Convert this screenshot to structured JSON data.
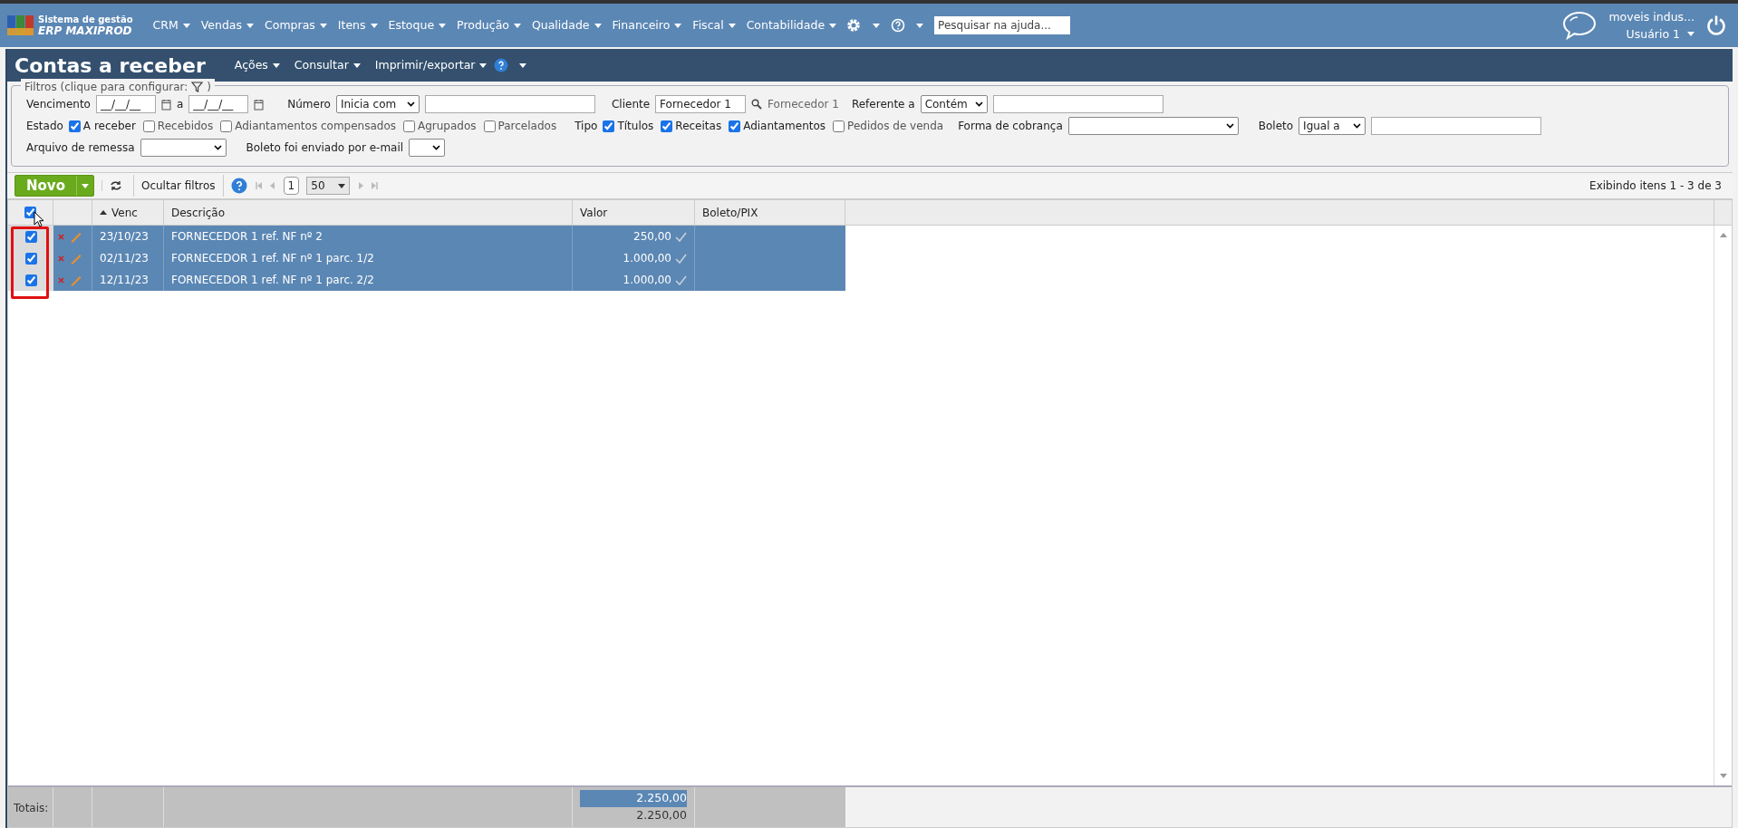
{
  "top_nav": {
    "logo": {
      "line1": "Sistema de gestão",
      "line2": "ERP MAXIPROD"
    },
    "menus": [
      "CRM",
      "Vendas",
      "Compras",
      "Itens",
      "Estoque",
      "Produção",
      "Qualidade",
      "Financeiro",
      "Fiscal",
      "Contabilidade"
    ],
    "search": {
      "placeholder": "Pesquisar na ajuda..."
    },
    "user": {
      "company": "moveis indus...",
      "name": "Usuário 1"
    }
  },
  "page": {
    "title": "Contas a receber",
    "actions": [
      "Ações",
      "Consultar",
      "Imprimir/exportar"
    ]
  },
  "filters": {
    "legend": "Filtros (clique para configurar:",
    "legend_end": ")",
    "vencimento": {
      "label": "Vencimento",
      "from": "__/__/__",
      "sep": "a",
      "to": "__/__/__"
    },
    "numero": {
      "label": "Número",
      "mode": "Inicia com"
    },
    "cliente": {
      "label": "Cliente",
      "value": "Fornecedor 1",
      "found": "Fornecedor 1"
    },
    "referente": {
      "label": "Referente a",
      "mode": "Contém"
    },
    "estado": {
      "label": "Estado",
      "options": [
        {
          "label": "A receber",
          "checked": true
        },
        {
          "label": "Recebidos",
          "checked": false
        },
        {
          "label": "Adiantamentos compensados",
          "checked": false
        },
        {
          "label": "Agrupados",
          "checked": false
        },
        {
          "label": "Parcelados",
          "checked": false
        }
      ]
    },
    "tipo": {
      "label": "Tipo",
      "options": [
        {
          "label": "Títulos",
          "checked": true
        },
        {
          "label": "Receitas",
          "checked": true
        },
        {
          "label": "Adiantamentos",
          "checked": true
        },
        {
          "label": "Pedidos de venda",
          "checked": false
        }
      ]
    },
    "forma_cobranca": {
      "label": "Forma de cobrança"
    },
    "boleto": {
      "label": "Boleto",
      "mode": "Igual a"
    },
    "arquivo_remessa": {
      "label": "Arquivo de remessa"
    },
    "boleto_email": {
      "label": "Boleto foi enviado por e-mail"
    }
  },
  "toolbar": {
    "new_button": "Novo",
    "hide_filters": "Ocultar filtros",
    "page": "1",
    "page_size": "50",
    "range": "Exibindo itens 1 - 3 de 3"
  },
  "table": {
    "select_all": true,
    "columns": [
      {
        "label": "Venc",
        "sorted": true
      },
      {
        "label": "Descrição",
        "sorted": false
      },
      {
        "label": "Valor",
        "sorted": false
      },
      {
        "label": "Boleto/PIX",
        "sorted": false
      }
    ],
    "rows": [
      {
        "checked": true,
        "selected": true,
        "venc": "23/10/23",
        "descricao": "FORNECEDOR 1 ref. NF nº 2",
        "valor": "250,00"
      },
      {
        "checked": true,
        "selected": true,
        "venc": "02/11/23",
        "descricao": "FORNECEDOR 1 ref. NF nº 1 parc. 1/2",
        "valor": "1.000,00"
      },
      {
        "checked": true,
        "selected": true,
        "venc": "12/11/23",
        "descricao": "FORNECEDOR 1 ref. NF nº 1 parc. 2/2",
        "valor": "1.000,00"
      }
    ],
    "totals": {
      "label": "Totais:",
      "selected_total": "2.250,00",
      "total": "2.250,00"
    }
  }
}
